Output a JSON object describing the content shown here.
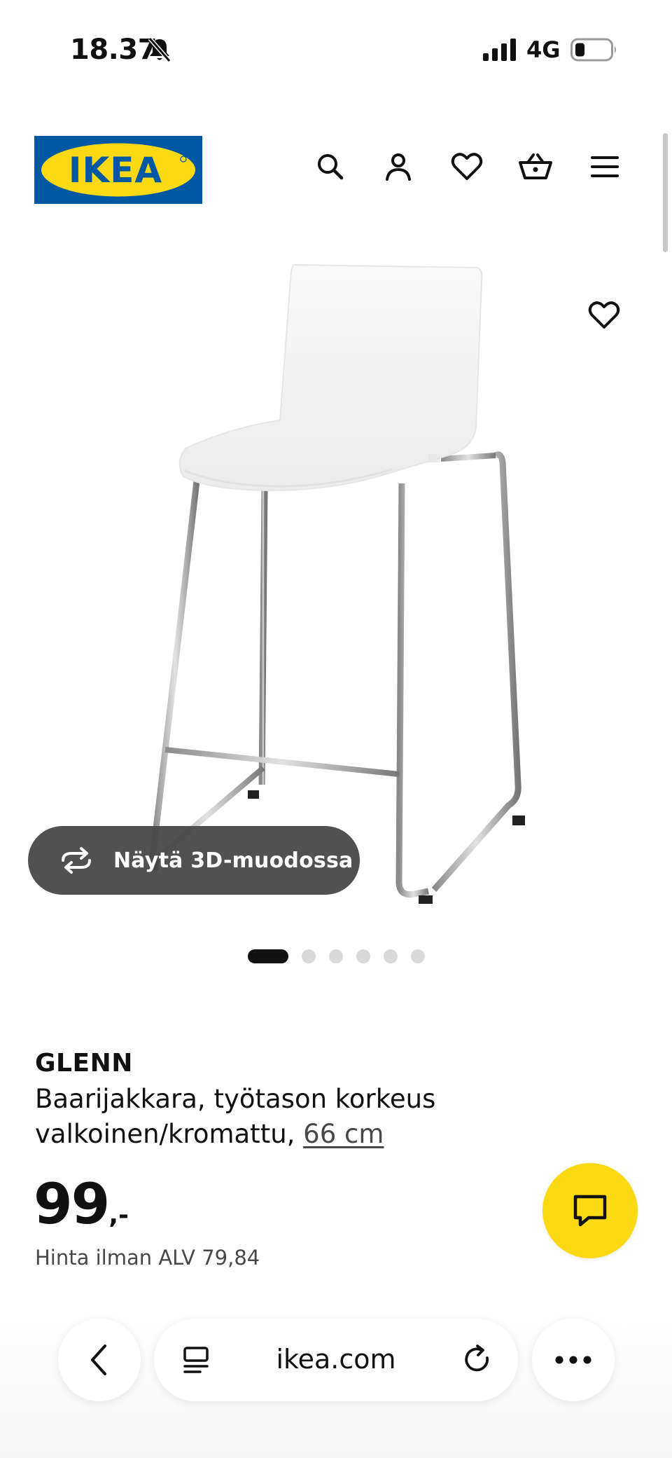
{
  "status_bar": {
    "time": "18.37",
    "network": "4G",
    "icons": [
      "bell-slash-icon",
      "signal-icon",
      "battery-icon"
    ]
  },
  "header": {
    "logo_text": "IKEA",
    "icons": [
      "search-icon",
      "account-icon",
      "favorites-icon",
      "cart-icon",
      "menu-icon"
    ]
  },
  "gallery": {
    "view_3d_label": "Näytä 3D-muodossa",
    "dots_total": 6,
    "active_dot": 1
  },
  "product": {
    "name": "GLENN",
    "desc_line1": "Baarijakkara, työtason korkeus",
    "desc_line2": "valkoinen/kromattu, ",
    "size_link": "66 cm",
    "price_main": "99",
    "price_suffix": ",-",
    "price_vat": "Hinta ilman ALV 79,84"
  },
  "browser": {
    "url": "ikea.com",
    "icons": [
      "back-icon",
      "tabs-icon",
      "reload-icon",
      "more-icon"
    ]
  },
  "colors": {
    "ikea_blue": "#0058a3",
    "ikea_yellow": "#fbd914",
    "overlay_grey": "#484848"
  }
}
